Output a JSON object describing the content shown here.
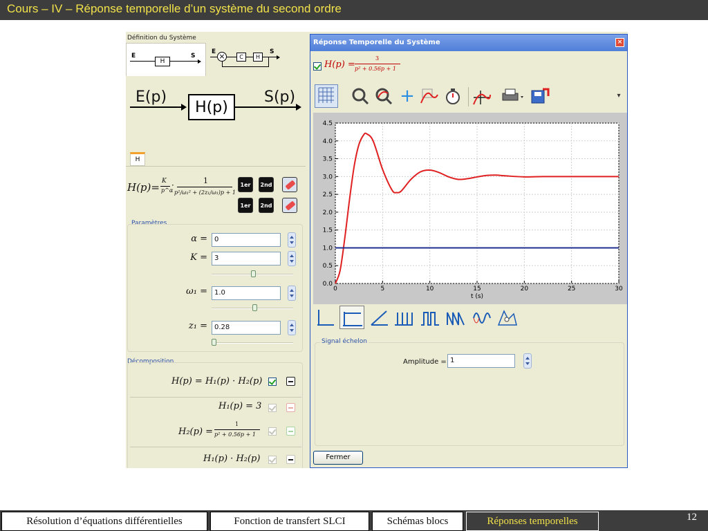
{
  "slide": {
    "title": "Cours – IV – Réponse temporelle d’un système du second ordre",
    "page_number": "12"
  },
  "left_panel": {
    "section_title": "Définition du Système",
    "small_diagram": {
      "input": "E",
      "block": "H",
      "output": "S"
    },
    "loop_diagram": {
      "input": "E",
      "block_c": "C",
      "block_h": "H",
      "output": "S"
    },
    "big_diagram": {
      "input": "E(p)",
      "block": "H(p)",
      "output": "S(p)"
    },
    "tab_label": "H",
    "transfer_formula": {
      "lhs": "H(p)=",
      "gain": "K",
      "gain_den": "p^α",
      "dot": "·",
      "num": "1",
      "den": "p²/ω₁² + (2z₁/ω₁)p + 1"
    },
    "order_buttons": [
      "1er",
      "2nd"
    ],
    "parameters": {
      "label": "Paramètres",
      "alpha": {
        "label": "α =",
        "value": "0"
      },
      "K": {
        "label": "K =",
        "value": "3"
      },
      "omega1": {
        "label": "ω₁ =",
        "value": "1.0"
      },
      "z1": {
        "label": "z₁ =",
        "value": "0.28"
      }
    },
    "decomposition": {
      "label": "Décomposition",
      "main": "H(p) = H₁(p) · H₂(p)",
      "h1": "H₁(p) = 3",
      "h2_lhs": "H₂(p) =",
      "h2_num": "1",
      "h2_den": "p² + 0.56p + 1",
      "product": "H₁(p) · H₂(p)"
    }
  },
  "window": {
    "title": "Réponse Temporelle du Système",
    "formula_lhs": "H(p) =",
    "formula_num": "3",
    "formula_den": "p² + 0.56p + 1",
    "toolbar_icons": [
      "grid-icon",
      "zoom-icon",
      "zoom-pan-icon",
      "crosshair-icon",
      "curve-icon",
      "stopwatch-icon",
      "response-time-icon",
      "print-icon",
      "save-icon",
      "menu-more-icon"
    ],
    "step_group_label": "Signal échelon",
    "amplitude_label": "Amplitude =",
    "amplitude_value": "1",
    "close_button": "Fermer"
  },
  "chart_data": {
    "type": "line",
    "xlabel": "t (s)",
    "ylabel": "",
    "xlim": [
      0,
      30
    ],
    "ylim": [
      0.0,
      4.5
    ],
    "x_ticks": [
      "0",
      "5",
      "10",
      "15",
      "20",
      "25",
      "30"
    ],
    "y_ticks": [
      "0.0",
      "0.5",
      "1.0",
      "1.5",
      "2.0",
      "2.5",
      "3.0",
      "3.5",
      "4.0",
      "4.5"
    ],
    "grid": true,
    "series": [
      {
        "color": "#e02020",
        "x": [
          0,
          0.5,
          1,
          1.5,
          2,
          2.5,
          3,
          3.3,
          4,
          5,
          6,
          6.5,
          7,
          8,
          9,
          10,
          11,
          12,
          13,
          14,
          15,
          16,
          17,
          18,
          20,
          22,
          25,
          30
        ],
        "y": [
          0.0,
          0.36,
          1.27,
          2.35,
          3.3,
          3.9,
          4.17,
          4.2,
          4.0,
          3.2,
          2.62,
          2.55,
          2.6,
          2.92,
          3.13,
          3.18,
          3.11,
          2.99,
          2.92,
          2.94,
          2.99,
          3.03,
          3.04,
          3.02,
          2.99,
          3.0,
          3.0,
          3.0
        ]
      },
      {
        "color": "#1f2f8f",
        "x": [
          0,
          30
        ],
        "y": [
          1.0,
          1.0
        ]
      }
    ]
  },
  "footer_nav": [
    {
      "label": "Résolution d’équations différentielles",
      "active": false
    },
    {
      "label": "Fonction de transfert SLCI",
      "active": false
    },
    {
      "label": "Schémas blocs",
      "active": false
    },
    {
      "label": "Réponses temporelles",
      "active": true
    }
  ]
}
